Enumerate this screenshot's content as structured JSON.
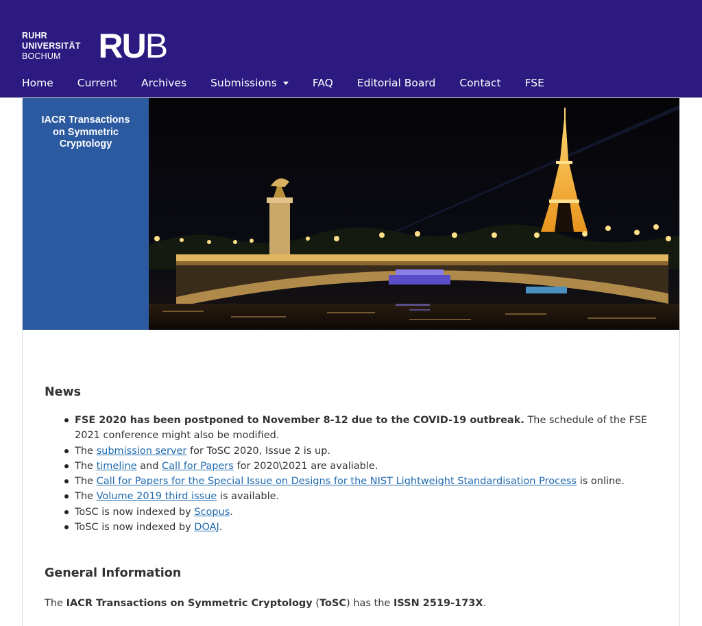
{
  "brand": {
    "line1": "RUHR",
    "line2": "UNIVERSITÄT",
    "line3": "BOCHUM",
    "big_ru": "RU",
    "big_b": "B",
    "header_bg": "#2c1a80"
  },
  "nav": {
    "home": "Home",
    "current": "Current",
    "archives": "Archives",
    "submissions": "Submissions",
    "faq": "FAQ",
    "editorial": "Editorial Board",
    "contact": "Contact",
    "fse": "FSE"
  },
  "banner": {
    "title_line1": "IACR Transactions",
    "title_line2": "on Symmetric",
    "title_line3": "Cryptology",
    "panel_color": "#2c5aa0"
  },
  "news": {
    "title": "News",
    "item1_bold": "FSE 2020 has been postponed to November 8-12 due to the COVID-19 outbreak.",
    "item1_rest": " The schedule of the FSE 2021 conference might also be modified.",
    "item2_pre": "The ",
    "item2_link": "submission server",
    "item2_post": " for ToSC 2020, Issue 2 is up.",
    "item3_pre": "The ",
    "item3_link1": "timeline",
    "item3_mid": " and ",
    "item3_link2": "Call for Papers",
    "item3_post": " for 2020\\2021 are avaliable.",
    "item4_pre": "The ",
    "item4_link": "Call for Papers for the Special Issue on Designs for the NIST Lightweight Standardisation Process",
    "item4_post": " is online.",
    "item5_pre": "The ",
    "item5_link": "Volume 2019 third issue",
    "item5_post": " is available.",
    "item6_pre": "ToSC is now indexed by ",
    "item6_link": "Scopus",
    "item6_post": ".",
    "item7_pre": "ToSC is now indexed by ",
    "item7_link": "DOAJ",
    "item7_post": "."
  },
  "general": {
    "title": "General Information",
    "p1": "The ",
    "p2": "IACR Transactions on Symmetric Cryptology",
    "p3": " (",
    "p4": "ToSC",
    "p5": ") has the ",
    "p6": "ISSN 2519-173X",
    "p7": "."
  },
  "colors": {
    "link": "#1e6ab0"
  }
}
